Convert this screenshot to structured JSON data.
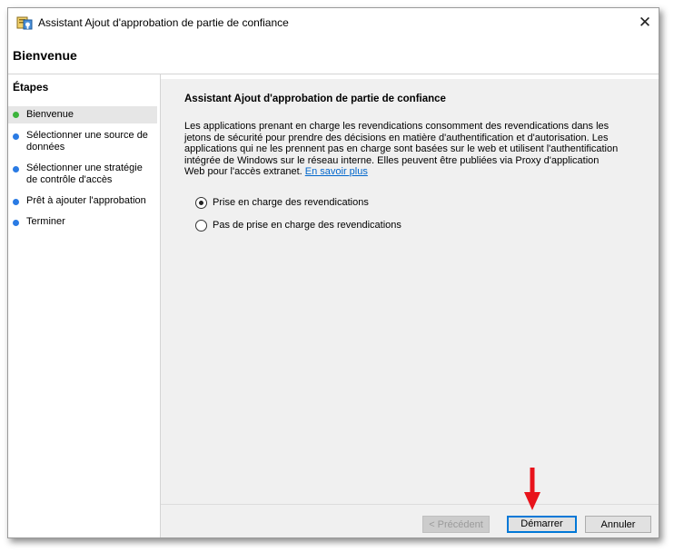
{
  "window": {
    "title": "Assistant Ajout d'approbation de partie de confiance",
    "close_glyph": "✕",
    "icon": "trust-certificate-icon"
  },
  "header": {
    "title": "Bienvenue"
  },
  "sidebar": {
    "title": "Étapes",
    "steps": [
      {
        "label": "Bienvenue",
        "state": "current",
        "color": "#3cb43c"
      },
      {
        "label": "Sélectionner une source de données",
        "state": "pending",
        "color": "#2a7be4"
      },
      {
        "label": "Sélectionner une stratégie de contrôle d'accès",
        "state": "pending",
        "color": "#2a7be4"
      },
      {
        "label": "Prêt à ajouter l'approbation",
        "state": "pending",
        "color": "#2a7be4"
      },
      {
        "label": "Terminer",
        "state": "pending",
        "color": "#2a7be4"
      }
    ]
  },
  "main": {
    "title": "Assistant Ajout d'approbation de partie de confiance",
    "description": "Les applications prenant en charge les revendications consomment des revendications dans les jetons de sécurité pour prendre des décisions en matière d'authentification et d'autorisation. Les applications qui ne les prennent pas en charge sont basées sur le web et utilisent l'authentification intégrée de Windows sur le réseau interne. Elles peuvent être publiées via Proxy d'application Web pour l'accès extranet.",
    "learn_more": "En savoir plus",
    "options": [
      {
        "label": "Prise en charge des revendications",
        "selected": true
      },
      {
        "label": "Pas de prise en charge des revendications",
        "selected": false
      }
    ]
  },
  "buttons": {
    "previous": "< Précédent",
    "start": "Démarrer",
    "cancel": "Annuler"
  },
  "annotation": {
    "arrow_color": "#e8131b",
    "points_to": "start-button"
  }
}
